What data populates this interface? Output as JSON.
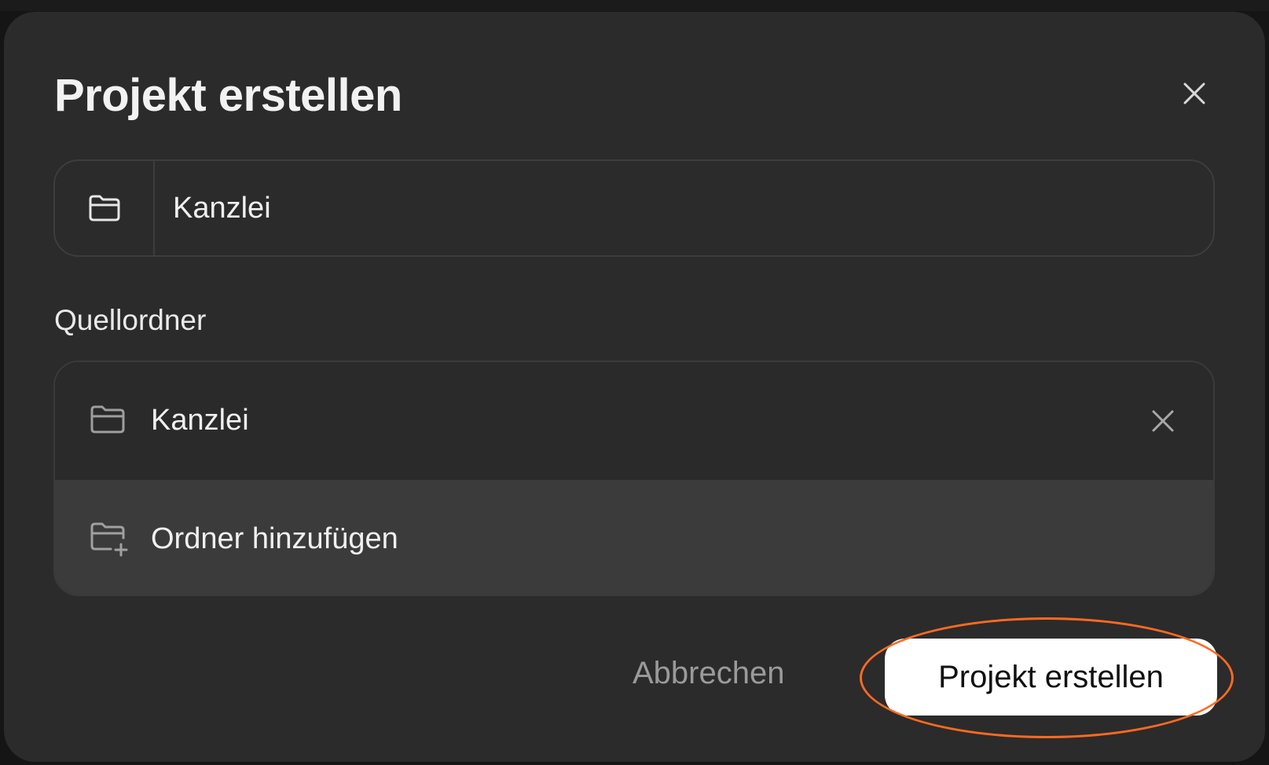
{
  "dialog": {
    "title": "Projekt erstellen",
    "close_icon": "close-icon"
  },
  "project_name": {
    "icon": "folder-icon",
    "value": "Kanzlei"
  },
  "source_folders": {
    "label": "Quellordner",
    "items": [
      {
        "icon": "folder-icon",
        "name": "Kanzlei",
        "remove_icon": "close-icon"
      }
    ],
    "add": {
      "icon": "folder-plus-icon",
      "label": "Ordner hinzufügen"
    }
  },
  "footer": {
    "cancel_label": "Abbrechen",
    "create_label": "Projekt erstellen"
  },
  "colors": {
    "dialog_background": "#2b2b2b",
    "accent_highlight": "#ff6a21",
    "primary_button": "#ffffff",
    "muted_text": "#9a9a9a"
  }
}
